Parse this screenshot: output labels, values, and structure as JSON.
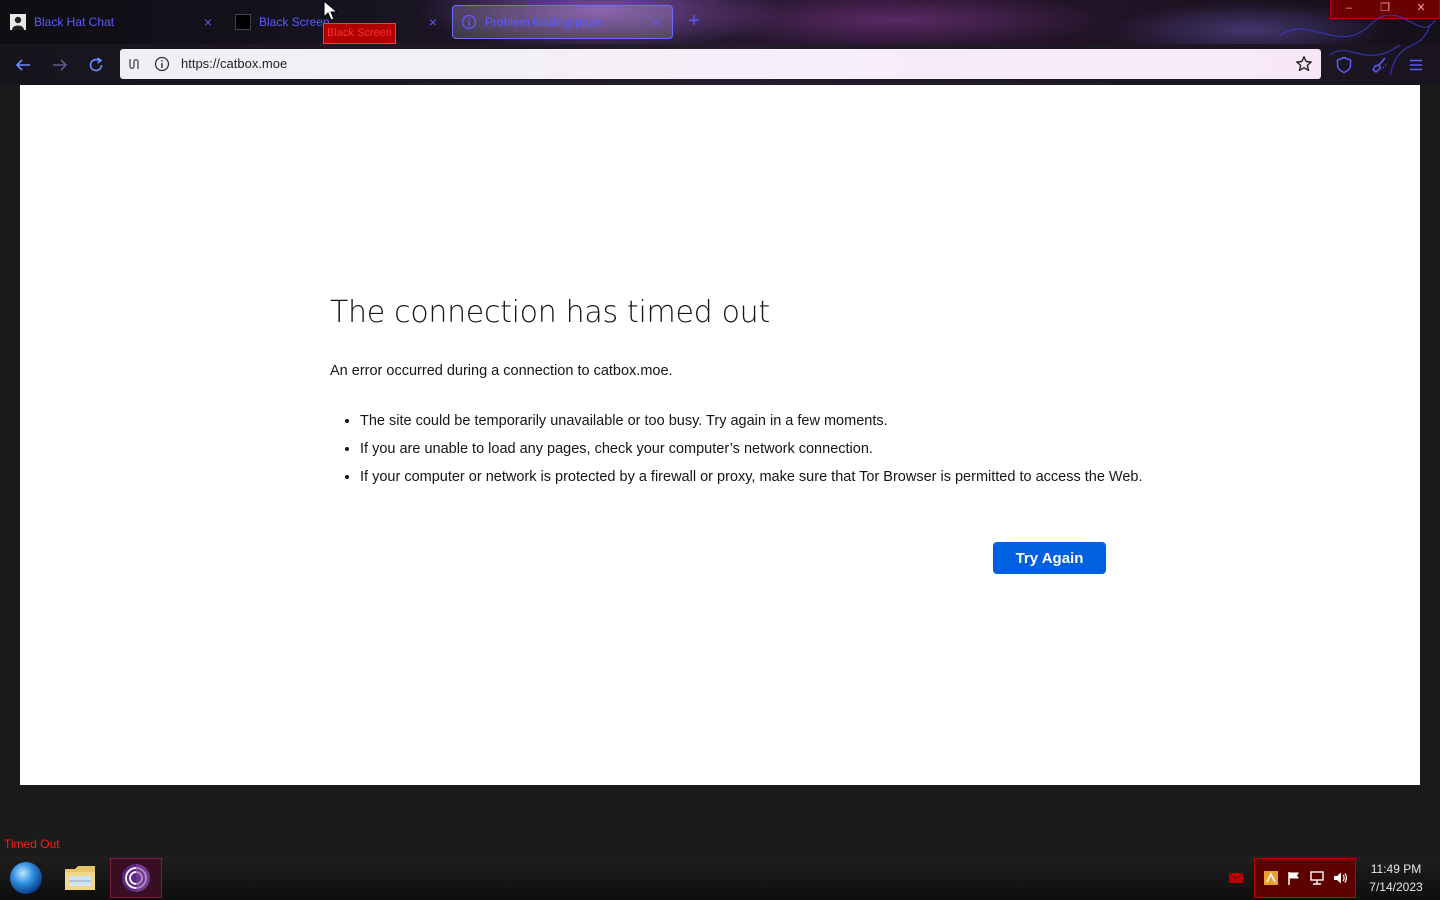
{
  "tabs": [
    {
      "title": "Black Hat Chat",
      "close": "×",
      "favicon": "person-icon",
      "active": false
    },
    {
      "title": "Black Screen",
      "close": "×",
      "favicon": "black-square-icon",
      "active": false
    },
    {
      "title": "Problem loading page",
      "close": "×",
      "favicon": "info-icon",
      "active": true
    }
  ],
  "new_tab": "+",
  "tooltip": "Black Screen",
  "window_controls": {
    "minimize": "–",
    "maximize": "❐",
    "close": "✕"
  },
  "nav": {
    "url": "https://catbox.moe"
  },
  "error": {
    "title": "The connection has timed out",
    "description": "An error occurred during a connection to catbox.moe.",
    "items": [
      "The site could be temporarily unavailable or too busy. Try again in a few moments.",
      "If you are unable to load any pages, check your computer’s network connection.",
      "If your computer or network is protected by a firewall or proxy, make sure that Tor Browser is permitted to access the Web."
    ],
    "button_label": "Try Again"
  },
  "status_text": "Timed Out",
  "taskbar": {
    "items": [
      "browser-globe-icon",
      "file-explorer-icon",
      "tor-browser-icon"
    ],
    "clock": {
      "time": "11:49 PM",
      "date": "7/14/2023"
    }
  },
  "colors": {
    "accent": "#0061e0",
    "tab_text": "#5b5bff",
    "status_red": "#ff1a1a"
  }
}
